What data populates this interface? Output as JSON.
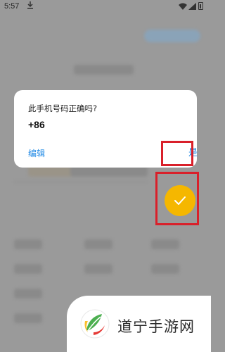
{
  "status_bar": {
    "time": "5:57"
  },
  "dialog": {
    "title": "此手机号码正确吗?",
    "phone_prefix": "+86",
    "edit_label": "编辑",
    "confirm_label": "是"
  },
  "watermark": {
    "text": "道宁手游网"
  },
  "colors": {
    "accent": "#1e88e5",
    "fab": "#f5b700",
    "highlight": "#d9202a",
    "scrim": "#9a9a9a"
  },
  "icons": {
    "fab": "checkmark-icon",
    "status_download": "download-icon",
    "status_wifi": "wifi-icon",
    "status_signal": "signal-icon",
    "status_battery": "battery-icon",
    "watermark_logo": "leaf-logo-icon"
  }
}
